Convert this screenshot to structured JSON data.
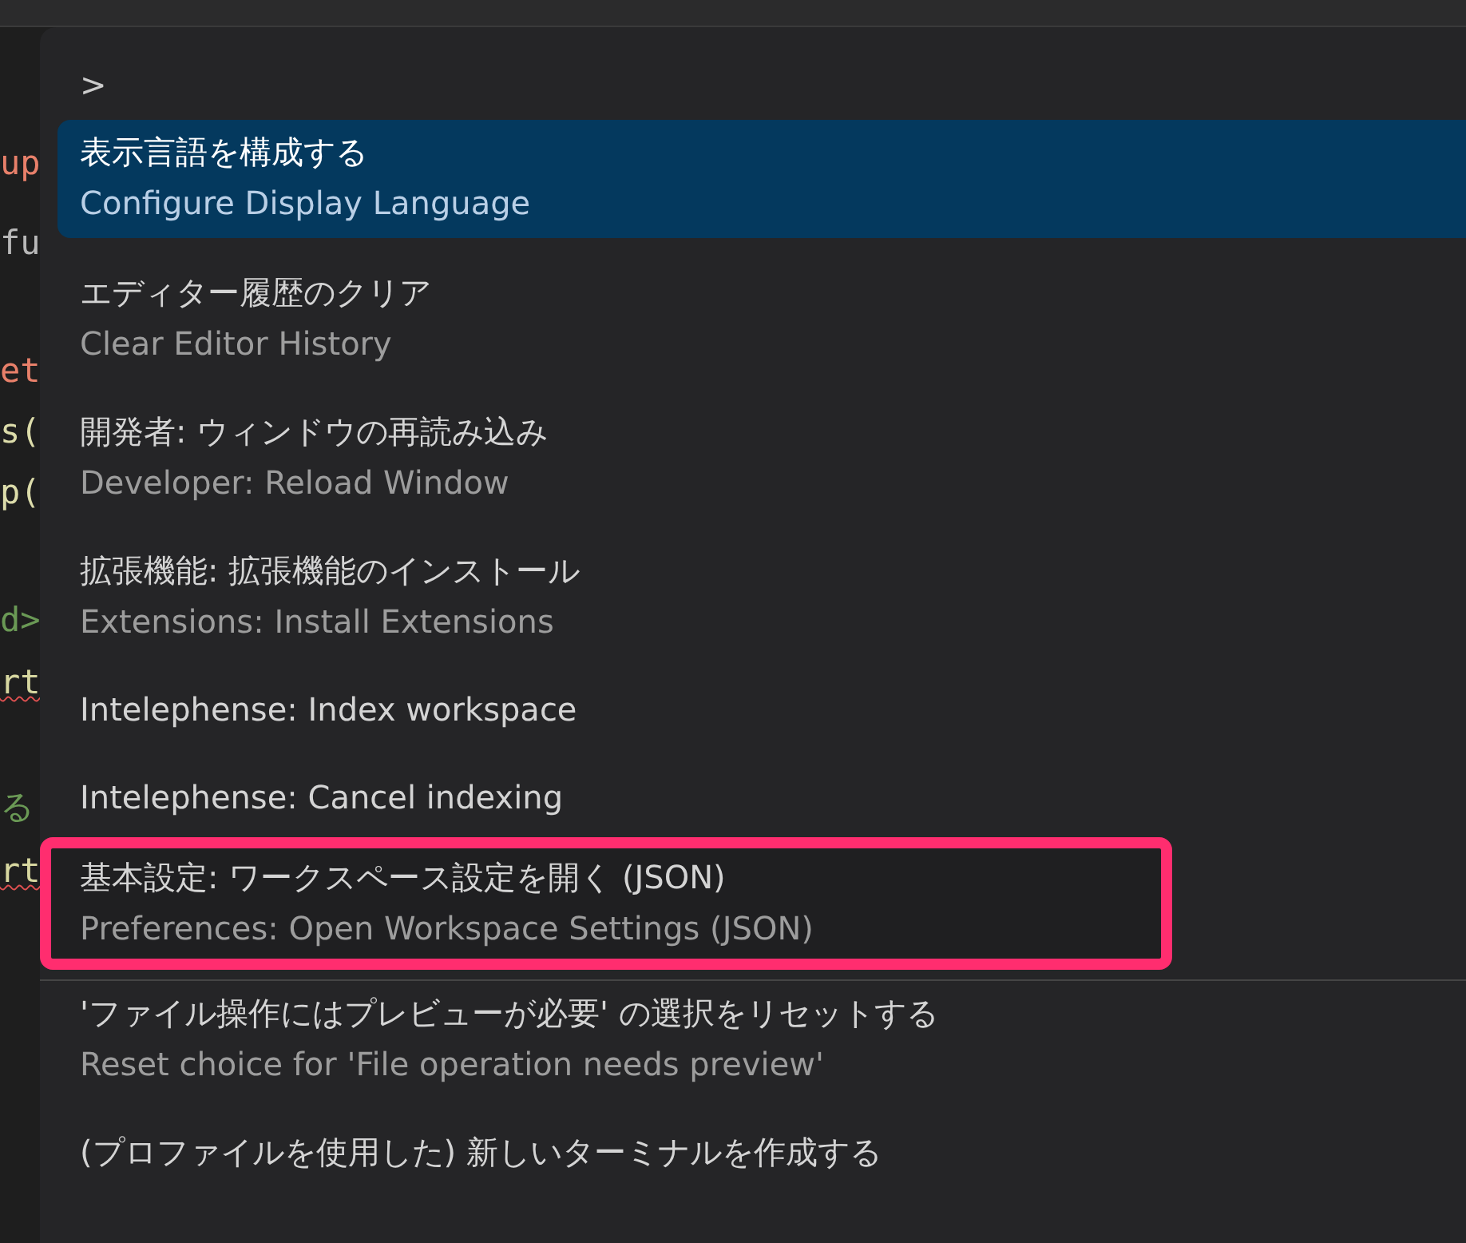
{
  "editor": {
    "code_fragments": [
      {
        "text": "up",
        "color": "#e8806a",
        "squiggle": false
      },
      {
        "text": "fu",
        "color": "#b8b8b8",
        "squiggle": false
      },
      {
        "text": "et",
        "color": "#e8806a",
        "squiggle": false
      },
      {
        "text": "s(",
        "color": "#dcdcaa",
        "squiggle": false
      },
      {
        "text": "p(",
        "color": "#dcdcaa",
        "squiggle": false
      },
      {
        "text": "d>",
        "color": "#6a9955",
        "squiggle": false
      },
      {
        "text": "rt",
        "color": "#d7d7a0",
        "squiggle": true
      },
      {
        "text": "る",
        "color": "#6a9955",
        "squiggle": false
      },
      {
        "text": "rt",
        "color": "#d7d7a0",
        "squiggle": true
      }
    ]
  },
  "command_palette": {
    "input": {
      "value": ">"
    },
    "items": [
      {
        "label": "表示言語を構成する",
        "detail": "Configure Display Language",
        "selected": true,
        "annotated": false,
        "separator_above": false
      },
      {
        "label": "エディター履歴のクリア",
        "detail": "Clear Editor History",
        "selected": false,
        "annotated": false,
        "separator_above": false
      },
      {
        "label": "開発者: ウィンドウの再読み込み",
        "detail": "Developer: Reload Window",
        "selected": false,
        "annotated": false,
        "separator_above": false
      },
      {
        "label": "拡張機能: 拡張機能のインストール",
        "detail": "Extensions: Install Extensions",
        "selected": false,
        "annotated": false,
        "separator_above": false
      },
      {
        "label": "Intelephense: Index workspace",
        "selected": false,
        "annotated": false,
        "separator_above": false
      },
      {
        "label": "Intelephense: Cancel indexing",
        "selected": false,
        "annotated": false,
        "separator_above": false
      },
      {
        "label": "基本設定: ワークスペース設定を開く (JSON)",
        "detail": "Preferences: Open Workspace Settings (JSON)",
        "selected": false,
        "annotated": true,
        "separator_above": false
      },
      {
        "label": "'ファイル操作にはプレビューが必要' の選択をリセットする",
        "detail": "Reset choice for 'File operation needs preview'",
        "selected": false,
        "annotated": false,
        "separator_above": true
      },
      {
        "label": "(プロファイルを使用した) 新しいターミナルを作成する",
        "selected": false,
        "annotated": false,
        "separator_above": false
      }
    ]
  }
}
